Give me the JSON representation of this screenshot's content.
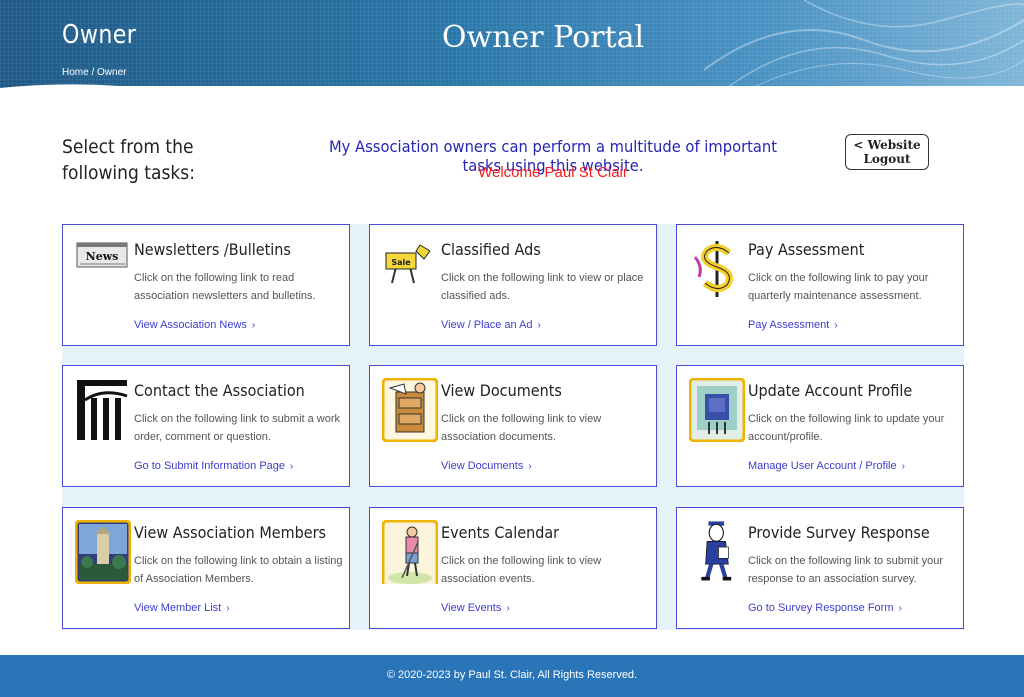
{
  "header": {
    "page_heading": "Owner",
    "breadcrumb": {
      "home": "Home",
      "separator": "/",
      "current": "Owner"
    },
    "portal_title": "Owner Portal"
  },
  "intro": {
    "select_text": "Select from the following tasks:",
    "message": "My Association owners can perform a multitude of important tasks using this website.",
    "welcome": "Welcome Paul St Clair",
    "logout_line1": "< Website",
    "logout_line2": "Logout"
  },
  "cards": [
    {
      "title": "Newsletters /Bulletins",
      "desc": "Click on the following link to read association newsletters and bulletins.",
      "link": "View Association News",
      "icon": "newspaper-icon",
      "icon_text": "News"
    },
    {
      "title": "Classified Ads",
      "desc": "Click on the following link to view or place classified ads.",
      "link": "View / Place an Ad",
      "icon": "sale-sign-icon",
      "icon_text": "Sale"
    },
    {
      "title": "Pay Assessment",
      "desc": "Click on the following link to pay your quarterly maintenance assessment.",
      "link": "Pay Assessment",
      "icon": "dollar-sign-icon"
    },
    {
      "title": "Contact the Association",
      "desc": "Click on the following link to submit a work order, comment or question.",
      "link": "Go to Submit Information Page",
      "icon": "building-icon"
    },
    {
      "title": "View Documents",
      "desc": "Click on the following link to view association documents.",
      "link": "View Documents",
      "icon": "file-cabinet-icon"
    },
    {
      "title": "Update Account Profile",
      "desc": "Click on the following link to update your account/profile.",
      "link": "Manage User Account / Profile",
      "icon": "profile-icon"
    },
    {
      "title": "View Association Members",
      "desc": "Click on the following link to obtain a listing of Association Members.",
      "link": "View Member List",
      "icon": "tower-photo-icon"
    },
    {
      "title": "Events Calendar",
      "desc": "Click on the following link to view association events.",
      "link": "View Events",
      "icon": "golfer-icon"
    },
    {
      "title": "Provide Survey Response",
      "desc": "Click on the following link to submit your response to an association survey.",
      "link": "Go to Survey Response Form",
      "icon": "survey-man-icon"
    }
  ],
  "link_chevron": "›",
  "footer": {
    "copyright": "© 2020-2023 by Paul St. Clair, All Rights Reserved."
  },
  "colors": {
    "header_blue": "#2a77aa",
    "card_border": "#4a4ad6",
    "link_blue": "#3d3dcc",
    "welcome_red": "#ff1a1a",
    "message_blue": "#2525b5",
    "footer_blue": "#2a74b8",
    "grid_bg": "#e6f3fb"
  }
}
